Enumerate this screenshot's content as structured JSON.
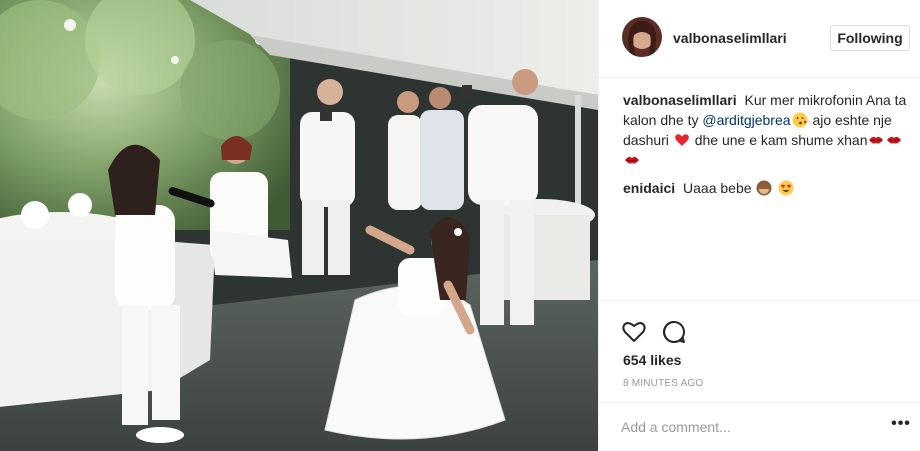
{
  "post": {
    "author": "valbonaselimllari",
    "follow_state": "Following",
    "caption": {
      "user": "valbonaselimllari",
      "text_1": "Kur mer mikrofonin Ana ta kalon dhe ty",
      "mention": "@arditgjebrea",
      "text_2": "ajo eshte nje dashuri",
      "text_3": "dhe une e kam shume xhan"
    },
    "comments": [
      {
        "user": "enidaici",
        "text": "Uaaa bebe"
      }
    ],
    "likes": "654 likes",
    "time": "8 MINUTES AGO",
    "add_comment_placeholder": "Add a comment...",
    "more_label": "•••"
  },
  "icons": {
    "like": "heart-outline-icon",
    "comment": "speech-bubble-icon",
    "more": "more-options-icon"
  },
  "colors": {
    "text": "#262626",
    "mention": "#003569",
    "muted": "#999999",
    "border": "#efefef",
    "heart_emoji": "#e0262e"
  }
}
